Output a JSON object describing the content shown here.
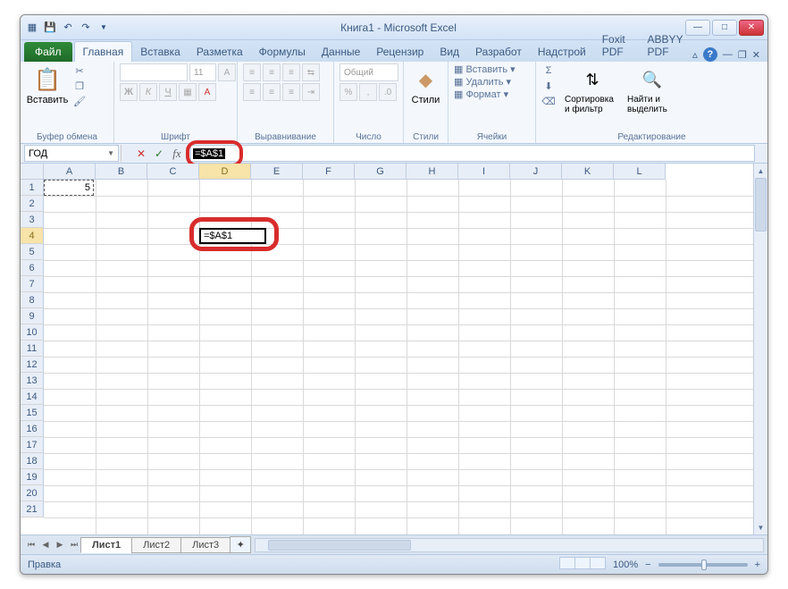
{
  "title": "Книга1  -  Microsoft Excel",
  "tabs": {
    "file": "Файл",
    "items": [
      "Главная",
      "Вставка",
      "Разметка",
      "Формулы",
      "Данные",
      "Рецензир",
      "Вид",
      "Разработ",
      "Надстрой",
      "Foxit PDF",
      "ABBYY PDF"
    ],
    "active": 0
  },
  "ribbon": {
    "clipboard": {
      "paste": "Вставить",
      "label": "Буфер обмена"
    },
    "font": {
      "label": "Шрифт",
      "size": "11"
    },
    "align": {
      "label": "Выравнивание"
    },
    "number": {
      "label": "Число",
      "format": "Общий"
    },
    "styles": {
      "label": "Стили",
      "btn": "Стили"
    },
    "cells": {
      "label": "Ячейки",
      "insert": "Вставить",
      "delete": "Удалить",
      "format": "Формат"
    },
    "editing": {
      "label": "Редактирование",
      "sort": "Сортировка и фильтр",
      "find": "Найти и выделить"
    }
  },
  "namebox": "ГОД",
  "formula": "=$A$1",
  "cells": {
    "a1": "5",
    "d4": "=$A$1"
  },
  "cols": [
    "A",
    "B",
    "C",
    "D",
    "E",
    "F",
    "G",
    "H",
    "I",
    "J",
    "K",
    "L"
  ],
  "rows": [
    "1",
    "2",
    "3",
    "4",
    "5",
    "6",
    "7",
    "8",
    "9",
    "10",
    "11",
    "12",
    "13",
    "14",
    "15",
    "16",
    "17",
    "18",
    "19",
    "20",
    "21"
  ],
  "sheets": {
    "items": [
      "Лист1",
      "Лист2",
      "Лист3"
    ],
    "active": 0
  },
  "status": "Правка",
  "zoom": "100%"
}
